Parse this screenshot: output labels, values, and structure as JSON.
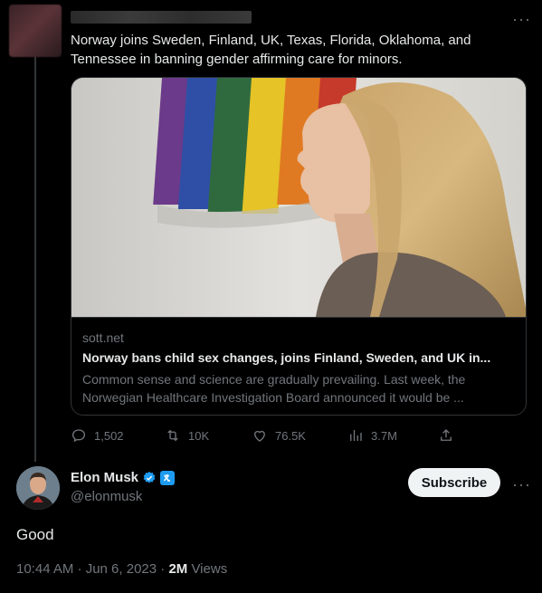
{
  "parent_tweet": {
    "text": "Norway joins Sweden, Finland, UK, Texas, Florida, Oklahoma, and Tennessee in banning gender affirming care for minors.",
    "card": {
      "domain": "sott.net",
      "title": "Norway bans child sex changes, joins Finland, Sweden, and UK in...",
      "description": "Common sense and science are gradually prevailing. Last week, the Norwegian Healthcare Investigation Board announced it would be ..."
    },
    "actions": {
      "replies": "1,502",
      "reposts": "10K",
      "likes": "76.5K",
      "views": "3.7M"
    }
  },
  "main_tweet": {
    "name": "Elon Musk",
    "handle": "@elonmusk",
    "subscribe_label": "Subscribe",
    "text": "Good",
    "time": "10:44 AM · Jun 6, 2023 · ",
    "views_count": "2M",
    "views_label": " Views"
  },
  "colors": {
    "background": "#000000",
    "muted": "#71767b",
    "accent": "#1d9bf0"
  }
}
